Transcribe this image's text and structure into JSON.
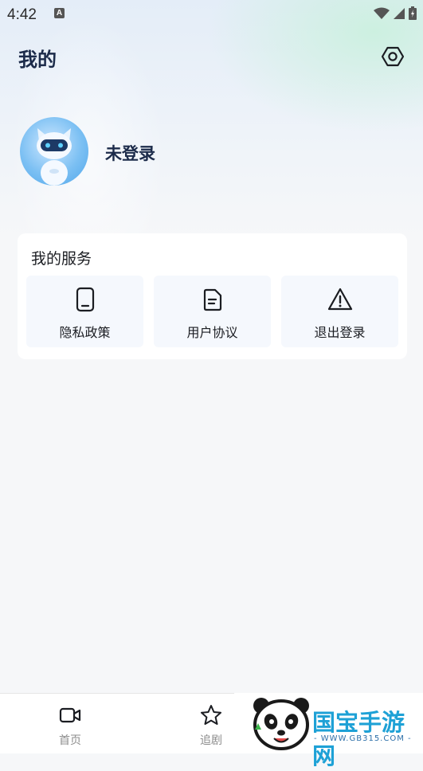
{
  "status_bar": {
    "time": "4:42",
    "notification_glyph": "A",
    "icons": [
      "wifi-icon",
      "signal-icon",
      "battery-icon"
    ]
  },
  "header": {
    "title": "我的",
    "settings_icon": "settings-hexagon-icon"
  },
  "profile": {
    "username": "未登录",
    "avatar_icon": "robot-avatar-icon"
  },
  "services": {
    "title": "我的服务",
    "items": [
      {
        "label": "隐私政策",
        "icon": "tablet-icon"
      },
      {
        "label": "用户协议",
        "icon": "document-icon"
      },
      {
        "label": "退出登录",
        "icon": "warning-icon"
      }
    ]
  },
  "tabbar": {
    "items": [
      {
        "label": "首页",
        "icon": "video-icon"
      },
      {
        "label": "追剧",
        "icon": "star-icon"
      }
    ]
  },
  "watermark": {
    "text": "国宝手游网",
    "url": "- WWW.GB315.COM -"
  },
  "colors": {
    "title": "#1c2b4a",
    "tile_bg": "#f5f8fd",
    "watermark": "#1ea1d6"
  }
}
